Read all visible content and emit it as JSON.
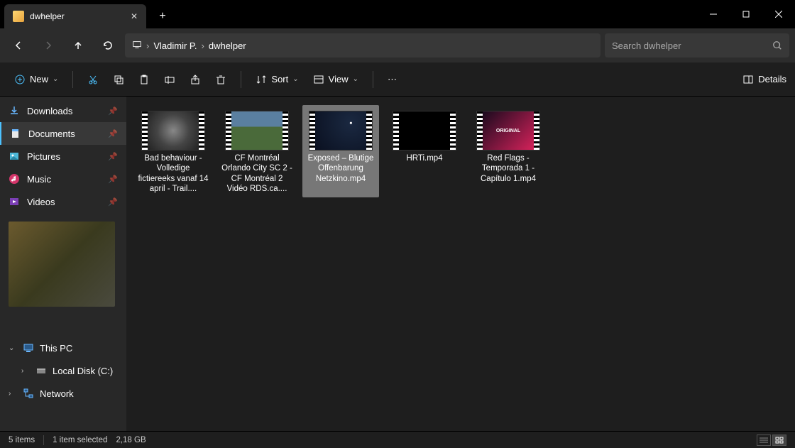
{
  "tab": {
    "title": "dwhelper"
  },
  "breadcrumb": {
    "items": [
      "Vladimir P.",
      "dwhelper"
    ]
  },
  "search": {
    "placeholder": "Search dwhelper"
  },
  "toolbar": {
    "new": "New",
    "sort": "Sort",
    "view": "View",
    "details": "Details"
  },
  "sidebar": {
    "quick": [
      {
        "label": "Downloads",
        "icon": "download",
        "pinned": true
      },
      {
        "label": "Documents",
        "icon": "document",
        "pinned": true,
        "active": true
      },
      {
        "label": "Pictures",
        "icon": "pictures",
        "pinned": true
      },
      {
        "label": "Music",
        "icon": "music",
        "pinned": true
      },
      {
        "label": "Videos",
        "icon": "videos",
        "pinned": true
      }
    ],
    "tree": [
      {
        "label": "This PC",
        "icon": "pc",
        "expanded": true
      },
      {
        "label": "Local Disk (C:)",
        "icon": "disk",
        "indent": 1
      },
      {
        "label": "Network",
        "icon": "network",
        "indent": 0
      }
    ]
  },
  "files": [
    {
      "name": "Bad behaviour - Volledige fictiereeks vanaf 14 april - Trail....",
      "thumb": "t1"
    },
    {
      "name": "CF Montréal Orlando City SC 2 - CF Montréal 2 Vidéo RDS.ca....",
      "thumb": "t2"
    },
    {
      "name": "Exposed – Blutige Offenbarung Netzkino.mp4",
      "thumb": "t3",
      "selected": true
    },
    {
      "name": "HRTi.mp4",
      "thumb": "t4"
    },
    {
      "name": "Red Flags - Temporada 1 - Capítulo 1.mp4",
      "thumb": "t5",
      "badge": "ORIGINAL"
    }
  ],
  "status": {
    "count": "5 items",
    "selection": "1 item selected",
    "size": "2,18 GB"
  }
}
